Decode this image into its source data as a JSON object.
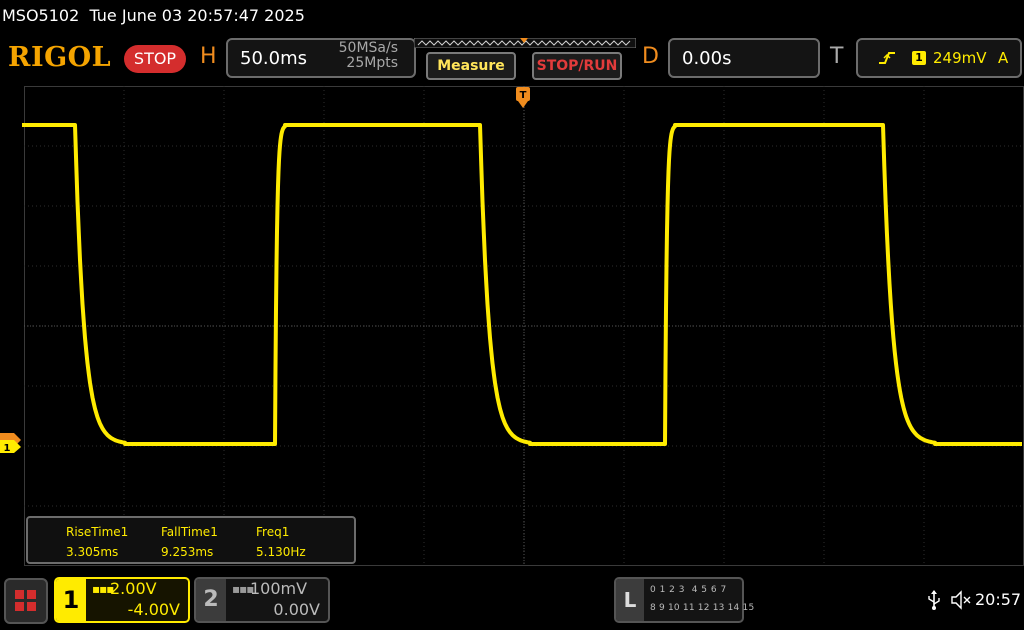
{
  "title_bar": {
    "text": "MSO5102  Tue June 03 20:57:47 2025"
  },
  "brand": {
    "logo": "RIGOL",
    "status": "STOP"
  },
  "horizontal": {
    "letter": "H",
    "timebase": "50.0ms",
    "sample_rate": "50MSa/s",
    "memory_depth": "25Mpts"
  },
  "buttons": {
    "measure": "Measure",
    "stop_run": "STOP/RUN"
  },
  "delay": {
    "letter": "D",
    "value": "0.00s"
  },
  "trigger": {
    "letter": "T",
    "edge_icon": "rising-edge-icon",
    "source": "1",
    "level": "249mV",
    "mode": "A"
  },
  "measurements": [
    {
      "name": "RiseTime1",
      "value": "3.305ms"
    },
    {
      "name": "FallTime1",
      "value": "9.253ms"
    },
    {
      "name": "Freq1",
      "value": "5.130Hz"
    }
  ],
  "channels": [
    {
      "number": "1",
      "coupling": "DC",
      "scale": "2.00V",
      "offset": "-4.00V",
      "color": "#ffeb00",
      "active": true
    },
    {
      "number": "2",
      "coupling": "DC",
      "scale": "100mV",
      "offset": "0.00V",
      "color": "#bbbbbb",
      "active": false
    }
  ],
  "logic": {
    "letter": "L",
    "row1": "0 1 2 3  4 5 6 7",
    "row2": "8 9 10 11 12 13 14 15"
  },
  "status": {
    "usb_icon": "usb-icon",
    "sound_icon": "speaker-muted-icon",
    "clock": "20:57"
  },
  "colors": {
    "trace": "#ffeb00",
    "accent": "#f08c1e",
    "stop": "#d42d2d"
  }
}
